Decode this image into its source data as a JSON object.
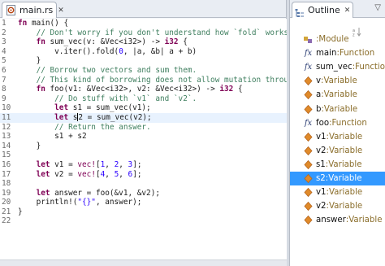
{
  "editor": {
    "tab": {
      "label": "main.rs",
      "close_glyph": "✕",
      "icon": "rust-file-icon"
    },
    "lines": [
      {
        "no": "1",
        "current": false,
        "parts": [
          [
            "kw",
            "fn"
          ],
          [
            "t",
            " main() {"
          ]
        ]
      },
      {
        "no": "2",
        "current": false,
        "parts": [
          [
            "cm",
            "    // Don't worry if you don't understand how `fold` works, th"
          ]
        ]
      },
      {
        "no": "3",
        "current": false,
        "parts": [
          [
            "kw",
            "    fn"
          ],
          [
            "t",
            " sum_vec(v: &Vec<i32>) -> "
          ],
          [
            "kw",
            "i32"
          ],
          [
            "t",
            " {"
          ]
        ]
      },
      {
        "no": "4",
        "current": false,
        "parts": [
          [
            "t",
            "        v.iter().fold("
          ],
          [
            "num",
            "0"
          ],
          [
            "t",
            ", |a, &b| a + b)"
          ]
        ]
      },
      {
        "no": "5",
        "current": false,
        "parts": [
          [
            "t",
            "    }"
          ]
        ]
      },
      {
        "no": "6",
        "current": false,
        "parts": [
          [
            "cm",
            "    // Borrow two vectors and sum them."
          ]
        ]
      },
      {
        "no": "7",
        "current": false,
        "parts": [
          [
            "cm",
            "    // This kind of borrowing does not allow mutation through"
          ]
        ]
      },
      {
        "no": "8",
        "current": false,
        "parts": [
          [
            "kw",
            "    fn"
          ],
          [
            "t",
            " foo(v1: &Vec<i32>, v2: &Vec<i32>) -> "
          ],
          [
            "kw",
            "i32"
          ],
          [
            "t",
            " {"
          ]
        ]
      },
      {
        "no": "9",
        "current": false,
        "parts": [
          [
            "cm",
            "        // Do stuff with `v1` and `v2`."
          ]
        ]
      },
      {
        "no": "10",
        "current": false,
        "parts": [
          [
            "kw",
            "        let"
          ],
          [
            "t",
            " s1 = sum_vec(v1);"
          ]
        ]
      },
      {
        "no": "11",
        "current": true,
        "parts": [
          [
            "kw",
            "        let"
          ],
          [
            "t",
            " s"
          ],
          [
            "caret",
            ""
          ],
          [
            "t",
            "2 = sum_vec(v2);"
          ]
        ]
      },
      {
        "no": "12",
        "current": false,
        "parts": [
          [
            "cm",
            "        // Return the answer."
          ]
        ]
      },
      {
        "no": "13",
        "current": false,
        "parts": [
          [
            "t",
            "        s1 + s2"
          ]
        ]
      },
      {
        "no": "14",
        "current": false,
        "parts": [
          [
            "t",
            "    }"
          ]
        ]
      },
      {
        "no": "15",
        "current": false,
        "parts": [
          [
            "t",
            ""
          ]
        ]
      },
      {
        "no": "16",
        "current": false,
        "parts": [
          [
            "kw",
            "    let"
          ],
          [
            "t",
            " v1 = "
          ],
          [
            "mac",
            "vec!"
          ],
          [
            "t",
            "["
          ],
          [
            "num",
            "1"
          ],
          [
            "t",
            ", "
          ],
          [
            "num",
            "2"
          ],
          [
            "t",
            ", "
          ],
          [
            "num",
            "3"
          ],
          [
            "t",
            "];"
          ]
        ]
      },
      {
        "no": "17",
        "current": false,
        "parts": [
          [
            "kw",
            "    let"
          ],
          [
            "t",
            " v2 = "
          ],
          [
            "mac",
            "vec!"
          ],
          [
            "t",
            "["
          ],
          [
            "num",
            "4"
          ],
          [
            "t",
            ", "
          ],
          [
            "num",
            "5"
          ],
          [
            "t",
            ", "
          ],
          [
            "num",
            "6"
          ],
          [
            "t",
            "];"
          ]
        ]
      },
      {
        "no": "18",
        "current": false,
        "parts": [
          [
            "t",
            ""
          ]
        ]
      },
      {
        "no": "19",
        "current": false,
        "parts": [
          [
            "kw",
            "    let"
          ],
          [
            "t",
            " answer = foo(&v1, &v2);"
          ]
        ]
      },
      {
        "no": "20",
        "current": false,
        "parts": [
          [
            "t",
            "    println!("
          ],
          [
            "str",
            "\"{}\""
          ],
          [
            "t",
            ", answer);"
          ]
        ]
      },
      {
        "no": "21",
        "current": false,
        "parts": [
          [
            "t",
            "}"
          ]
        ]
      },
      {
        "no": "22",
        "current": false,
        "parts": [
          [
            "t",
            ""
          ]
        ]
      }
    ]
  },
  "outline": {
    "tab": {
      "label": "Outline",
      "close_glyph": "✕",
      "icon": "outline-icon"
    },
    "view_menu_glyph": "▽",
    "sort_icon": "sort-icon",
    "items": [
      {
        "kind": "module",
        "name": "",
        "type": ":Module",
        "selected": false
      },
      {
        "kind": "function",
        "name": "main",
        "type": " :Function",
        "selected": false
      },
      {
        "kind": "function",
        "name": "sum_vec",
        "type": " :Function",
        "selected": false
      },
      {
        "kind": "variable",
        "name": "v",
        "type": " :Variable",
        "selected": false
      },
      {
        "kind": "variable",
        "name": "a",
        "type": " :Variable",
        "selected": false
      },
      {
        "kind": "variable",
        "name": "b",
        "type": " :Variable",
        "selected": false
      },
      {
        "kind": "function",
        "name": "foo",
        "type": " :Function",
        "selected": false
      },
      {
        "kind": "variable",
        "name": "v1",
        "type": " :Variable",
        "selected": false
      },
      {
        "kind": "variable",
        "name": "v2",
        "type": " :Variable",
        "selected": false
      },
      {
        "kind": "variable",
        "name": "s1",
        "type": " :Variable",
        "selected": false
      },
      {
        "kind": "variable",
        "name": "s2",
        "type": " :Variable",
        "selected": true
      },
      {
        "kind": "variable",
        "name": "v1",
        "type": " :Variable",
        "selected": false
      },
      {
        "kind": "variable",
        "name": "v2",
        "type": " :Variable",
        "selected": false
      },
      {
        "kind": "variable",
        "name": "answer",
        "type": " :Variable",
        "selected": false
      }
    ]
  },
  "colors": {
    "keyword": "#7f0055",
    "comment": "#3f7f5f",
    "number": "#2a00ff",
    "selection": "#3399ff",
    "current_line": "#e8f2fe",
    "type_label": "#8a6d2a"
  }
}
